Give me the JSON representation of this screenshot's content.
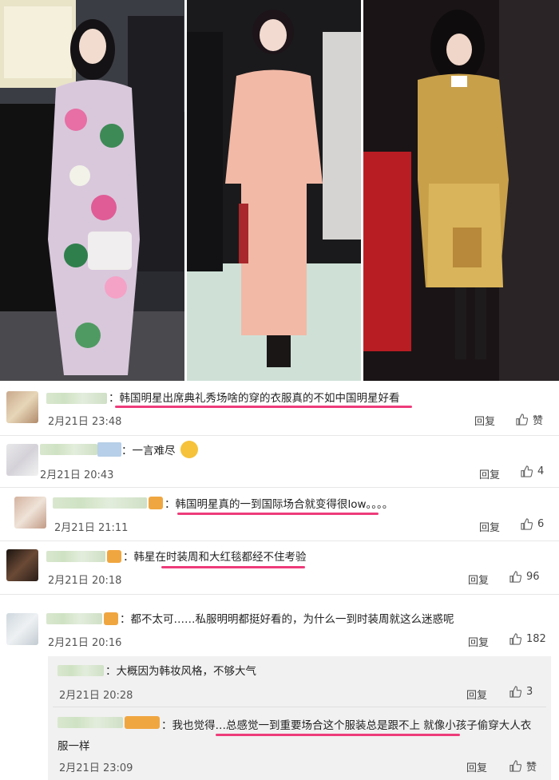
{
  "colors": {
    "highlight": "#ee3c7a",
    "subreply_bg": "#f1f1f1"
  },
  "photos": [
    {
      "alt": "photo-left"
    },
    {
      "alt": "photo-middle"
    },
    {
      "alt": "photo-right"
    }
  ],
  "comments": [
    {
      "text": "：韩国明星出席典礼秀场啥的穿的衣服真的不如中国明星好看",
      "time": "2月21日 23:48",
      "reply": "回复",
      "like": "赞"
    },
    {
      "text": "：一言难尽",
      "time": "2月21日 20:43",
      "reply": "回复",
      "like": "4"
    },
    {
      "text": "：韩国明星真的一到国际场合就变得很low。。。。",
      "time": "2月21日 21:11",
      "reply": "回复",
      "like": "6"
    },
    {
      "text": "：韩星在时装周和大红毯都经不住考验",
      "time": "2月21日 20:18",
      "reply": "回复",
      "like": "96"
    },
    {
      "text": "：都不太可……私服明明都挺好看的，为什么一到时装周就这么迷惑呢",
      "time": "2月21日 20:16",
      "reply": "回复",
      "like": "182"
    }
  ],
  "replies": [
    {
      "text": "：大概因为韩妆风格，不够大气",
      "time": "2月21日 20:28",
      "reply": "回复",
      "like": "3"
    },
    {
      "text": "：我也觉得…总感觉一到重要场合这个服装总是跟不上 就像小孩子偷穿大人衣服一样",
      "time": "2月21日 23:09",
      "reply": "回复",
      "like": "赞"
    }
  ]
}
